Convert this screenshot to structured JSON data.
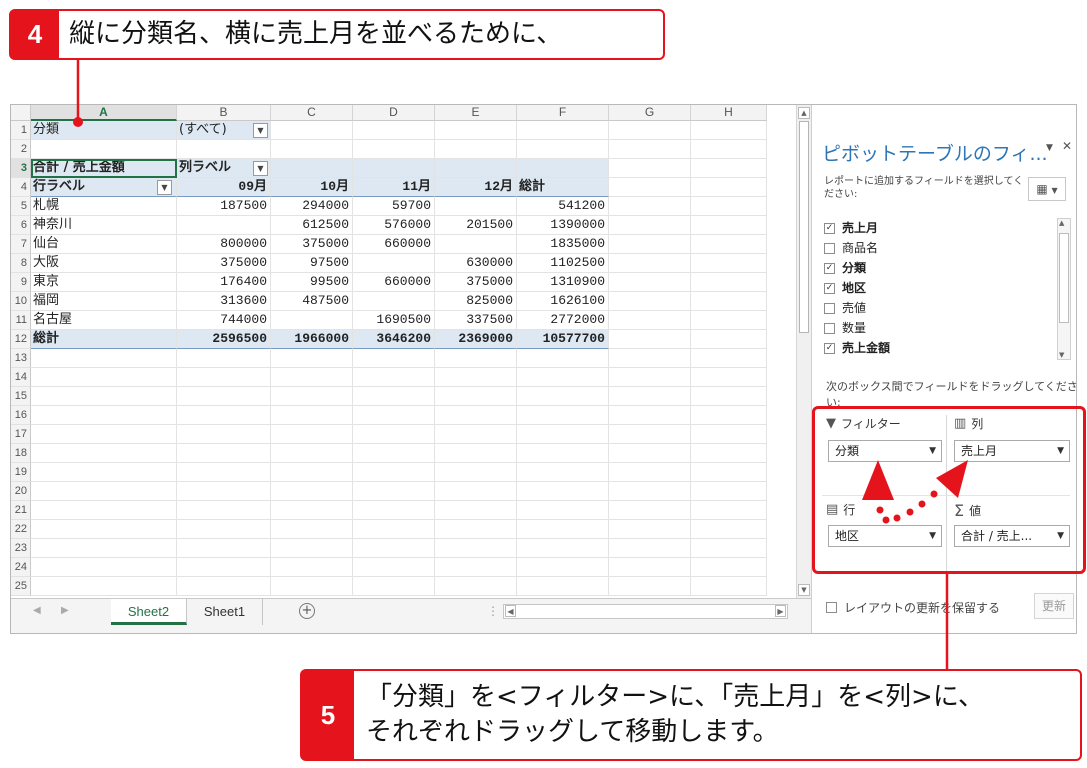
{
  "callouts": {
    "step4": {
      "number": "4",
      "text": "縦に分類名、横に売上月を並べるために、"
    },
    "step5": {
      "number": "5",
      "line1": "「分類」を<フィルター>に、「売上月」を<列>に、",
      "line2": "それぞれドラッグして移動します。"
    }
  },
  "spreadsheet": {
    "columns": [
      "A",
      "B",
      "C",
      "D",
      "E",
      "F",
      "G",
      "H"
    ],
    "row_numbers": [
      "1",
      "2",
      "3",
      "4",
      "5",
      "6",
      "7",
      "8",
      "9",
      "10",
      "11",
      "12",
      "13",
      "14",
      "15",
      "16",
      "17",
      "18",
      "19",
      "20",
      "21",
      "22",
      "23",
      "24",
      "25"
    ],
    "filter_row": {
      "label": "分類",
      "value": "(すべて)"
    },
    "header_row": {
      "label": "合計 / 売上金額",
      "col_label": "列ラベル"
    },
    "month_row": {
      "label": "行ラベル",
      "months": [
        "09月",
        "10月",
        "11月",
        "12月"
      ],
      "total": "総計"
    },
    "data_rows": [
      {
        "label": "札幌",
        "values": [
          "187500",
          "294000",
          "59700",
          ""
        ],
        "total": "541200"
      },
      {
        "label": "神奈川",
        "values": [
          "",
          "612500",
          "576000",
          "201500"
        ],
        "total": "1390000"
      },
      {
        "label": "仙台",
        "values": [
          "800000",
          "375000",
          "660000",
          ""
        ],
        "total": "1835000"
      },
      {
        "label": "大阪",
        "values": [
          "375000",
          "97500",
          "",
          "630000"
        ],
        "total": "1102500"
      },
      {
        "label": "東京",
        "values": [
          "176400",
          "99500",
          "660000",
          "375000"
        ],
        "total": "1310900"
      },
      {
        "label": "福岡",
        "values": [
          "313600",
          "487500",
          "",
          "825000"
        ],
        "total": "1626100"
      },
      {
        "label": "名古屋",
        "values": [
          "744000",
          "",
          "1690500",
          "337500"
        ],
        "total": "2772000"
      }
    ],
    "grand_total_row": {
      "label": "総計",
      "values": [
        "2596500",
        "1966000",
        "3646200",
        "2369000"
      ],
      "total": "10577700"
    }
  },
  "sheet_tabs": [
    "Sheet2",
    "Sheet1"
  ],
  "pivot_panel": {
    "title": "ピボットテーブルのフィ...",
    "subtitle": "レポートに追加するフィールドを選択してください:",
    "fields": [
      {
        "label": "売上月",
        "checked": true
      },
      {
        "label": "商品名",
        "checked": false
      },
      {
        "label": "分類",
        "checked": true
      },
      {
        "label": "地区",
        "checked": true
      },
      {
        "label": "売値",
        "checked": false
      },
      {
        "label": "数量",
        "checked": false
      },
      {
        "label": "売上金額",
        "checked": true
      }
    ],
    "drag_hint": "次のボックス間でフィールドをドラッグしてください:",
    "areas": {
      "filter": {
        "label": "フィルター",
        "field": "分類"
      },
      "columns": {
        "label": "列",
        "field": "売上月"
      },
      "rows": {
        "label": "行",
        "field": "地区"
      },
      "values": {
        "label": "値",
        "field": "合計 / 売上..."
      }
    },
    "defer_label": "レイアウトの更新を保留する",
    "update_button": "更新"
  },
  "colors": {
    "accent_red": "#e5141c",
    "excel_green": "#217346",
    "pivot_header_blue": "#dde8f3",
    "panel_title_blue": "#2e75b6"
  }
}
